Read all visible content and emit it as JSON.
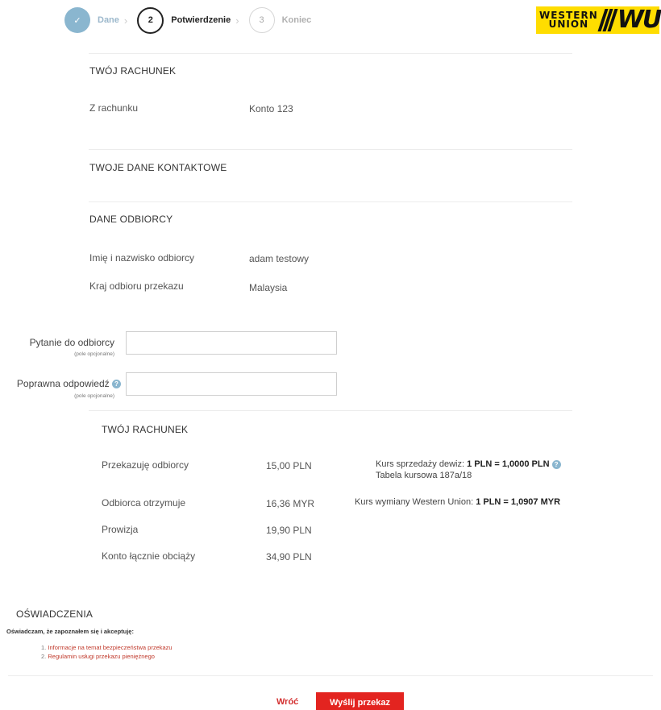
{
  "stepper": {
    "steps": [
      {
        "marker": "✓",
        "label": "Dane"
      },
      {
        "marker": "2",
        "label": "Potwierdzenie"
      },
      {
        "marker": "3",
        "label": "Koniec"
      }
    ]
  },
  "logo": {
    "line1": "WESTERN",
    "line2": "UNION",
    "mark": "WU"
  },
  "account": {
    "heading": "TWÓJ RACHUNEK",
    "from_label": "Z rachunku",
    "from_value": "Konto 123"
  },
  "contact": {
    "heading": "TWOJE DANE KONTAKTOWE"
  },
  "recipient": {
    "heading": "DANE ODBIORCY",
    "name_label": "Imię i nazwisko odbiorcy",
    "name_value": "adam testowy",
    "country_label": "Kraj odbioru przekazu",
    "country_value": "Malaysia"
  },
  "form": {
    "question_label": "Pytanie do odbiorcy",
    "question_sub": "(pole opcjonalne)",
    "question_value": "",
    "answer_label": "Poprawna odpowiedź",
    "answer_sub": "(pole opcjonalne)",
    "answer_value": ""
  },
  "summary": {
    "heading": "TWÓJ RACHUNEK",
    "transfer_label": "Przekazuję odbiorcy",
    "transfer_value": "15,00 PLN",
    "rate_prefix": "Kurs sprzedaży dewiz: ",
    "rate_bold": "1 PLN = 1,0000 PLN",
    "rate_table": "Tabela kursowa 187a/18",
    "receives_label": "Odbiorca otrzymuje",
    "receives_value": "16,36 MYR",
    "wu_rate_prefix": "Kurs wymiany Western Union: ",
    "wu_rate_bold": "1 PLN = 1,0907 MYR",
    "fee_label": "Prowizja",
    "fee_value": "19,90 PLN",
    "total_label": "Konto łącznie obciąży",
    "total_value": "34,90 PLN"
  },
  "declarations": {
    "heading": "OŚWIADCZENIA",
    "statement": "Oświadczam, że zapoznałem się i akceptuję:",
    "items": [
      {
        "num": "1.",
        "text": "Informacje na temat bezpieczeństwa przekazu"
      },
      {
        "num": "2.",
        "text": "Regulamin usługi przekazu pieniężnego"
      }
    ]
  },
  "actions": {
    "back": "Wróć",
    "send": "Wyślij przekaz"
  },
  "colors": {
    "accent": "#e32420",
    "step_done": "#8ab6cf",
    "logo": "#ffdd00"
  }
}
